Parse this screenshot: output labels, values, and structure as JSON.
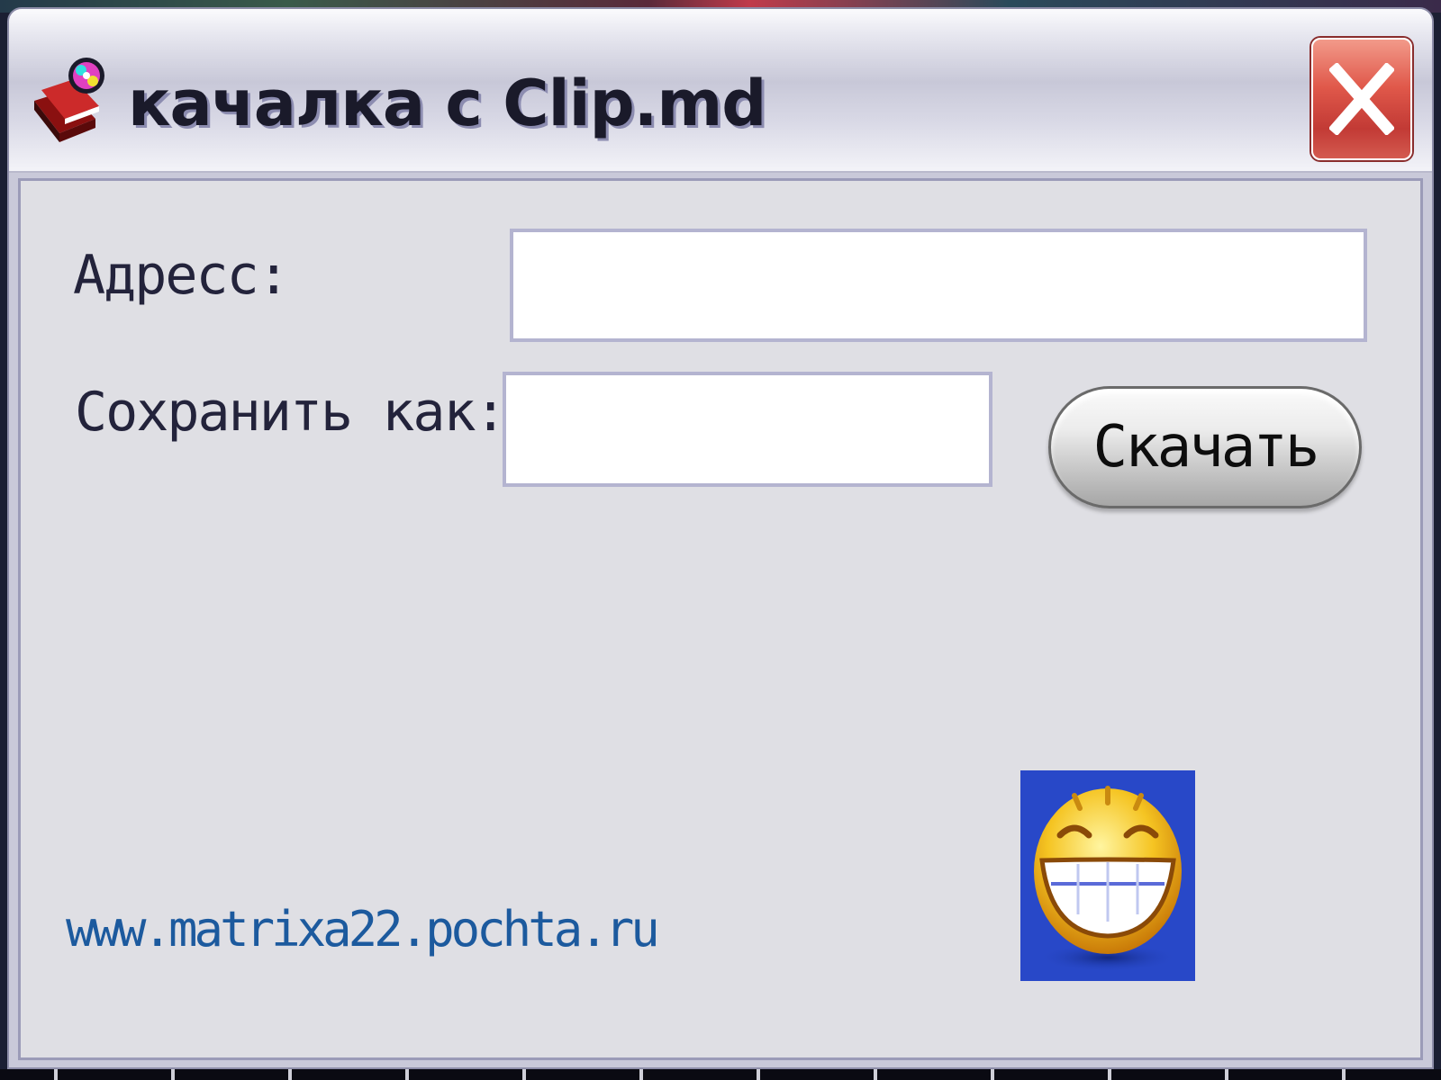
{
  "window": {
    "title": "качалка с Clip.md",
    "close_label": "close"
  },
  "form": {
    "address_label": "Адресс:",
    "address_value": "",
    "saveas_label": "Сохранить как:",
    "saveas_value": "",
    "download_button": "Скачать"
  },
  "footer": {
    "link_text": "www.matrixa22.pochta.ru"
  },
  "icons": {
    "app": "app-books-icon",
    "close": "close-icon",
    "smiley": "grinning-smiley-icon"
  },
  "colors": {
    "close_red": "#d9473f",
    "link_blue": "#1c5a9e",
    "smiley_bg": "#2848c8"
  }
}
